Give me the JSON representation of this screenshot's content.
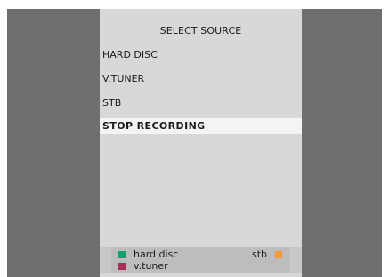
{
  "menu": {
    "title": "SELECT SOURCE",
    "items": [
      {
        "label": "HARD  DISC",
        "selected": false
      },
      {
        "label": "V.TUNER",
        "selected": false
      },
      {
        "label": "STB",
        "selected": false
      },
      {
        "label": "STOP  RECORDING",
        "selected": true
      }
    ]
  },
  "footer": {
    "hard_disc_label": "hard disc",
    "vtuner_label": "v.tuner",
    "stb_label": "stb",
    "colors": {
      "green": "#12a06a",
      "red": "#a6305a",
      "orange": "#f39a3a"
    }
  }
}
